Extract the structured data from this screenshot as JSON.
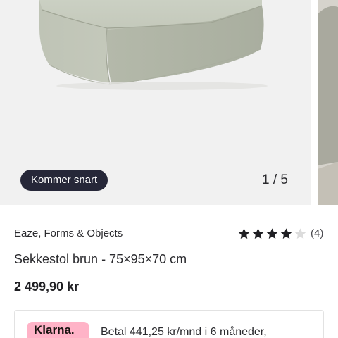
{
  "gallery": {
    "badge_label": "Kommer snart",
    "counter_text": "1 / 5"
  },
  "product": {
    "brand": "Eaze, Forms & Objects",
    "rating_value": 4,
    "rating_max": 5,
    "rating_count": "(4)",
    "title": "Sekkestol brun - 75×95×70 cm",
    "price": "2 499,90 kr"
  },
  "payment": {
    "provider_logo": "Klarna.",
    "installment_text": "Betal 441,25 kr/mnd i 6 måneder,"
  },
  "colors": {
    "badge_bg": "#262738",
    "star_filled": "#1f1f23",
    "star_empty": "#dcdcdc",
    "klarna_pink": "#ffb3c7",
    "product_fabric": "#c3c8bb"
  },
  "icons": {
    "star": "star-icon"
  }
}
